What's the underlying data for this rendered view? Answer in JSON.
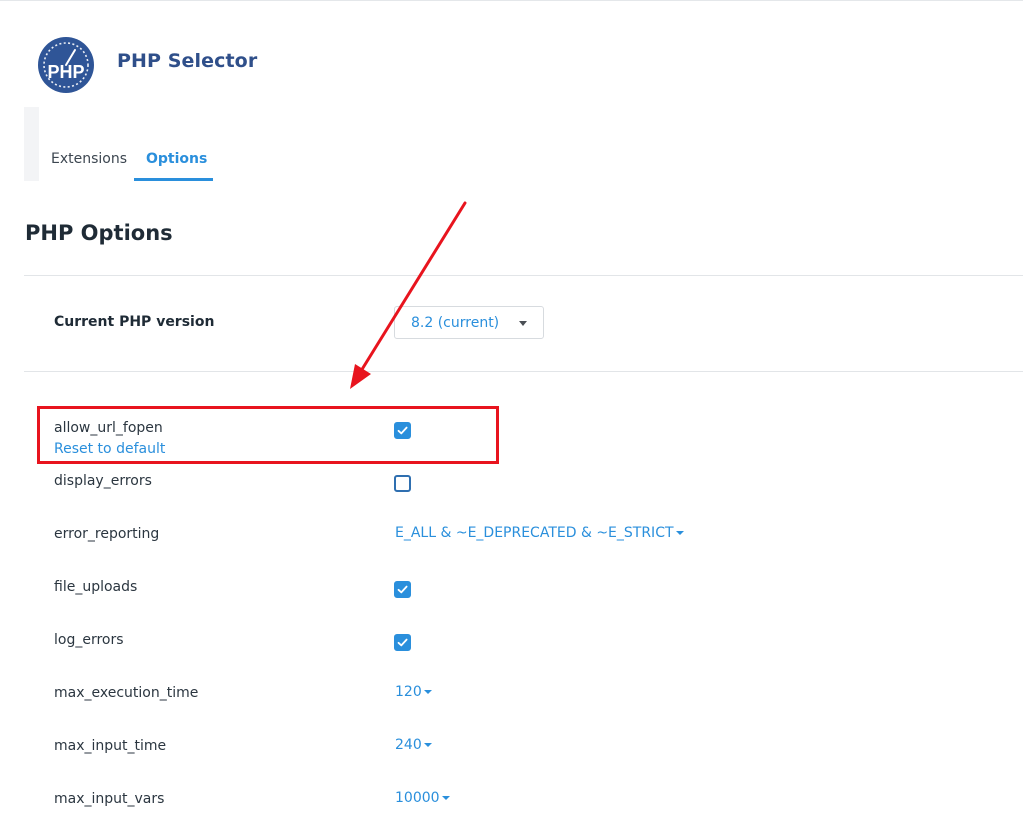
{
  "header": {
    "logo_text": "PHP",
    "title": "PHP Selector"
  },
  "tabs": [
    {
      "label": "Extensions",
      "active": false
    },
    {
      "label": "Options",
      "active": true
    }
  ],
  "section": {
    "title": "PHP Options"
  },
  "version": {
    "label": "Current PHP version",
    "selected": "8.2 (current)"
  },
  "options": {
    "allow_url_fopen": {
      "name": "allow_url_fopen",
      "checked": true,
      "reset_label": "Reset to default"
    },
    "display_errors": {
      "name": "display_errors",
      "checked": false
    },
    "error_reporting": {
      "name": "error_reporting",
      "value": "E_ALL & ~E_DEPRECATED & ~E_STRICT"
    },
    "file_uploads": {
      "name": "file_uploads",
      "checked": true
    },
    "log_errors": {
      "name": "log_errors",
      "checked": true
    },
    "max_execution_time": {
      "name": "max_execution_time",
      "value": "120"
    },
    "max_input_time": {
      "name": "max_input_time",
      "value": "240"
    },
    "max_input_vars": {
      "name": "max_input_vars",
      "value": "10000"
    }
  },
  "colors": {
    "accent": "#2a8fdc",
    "title": "#2f4f8a",
    "annotation": "#e8141e"
  }
}
